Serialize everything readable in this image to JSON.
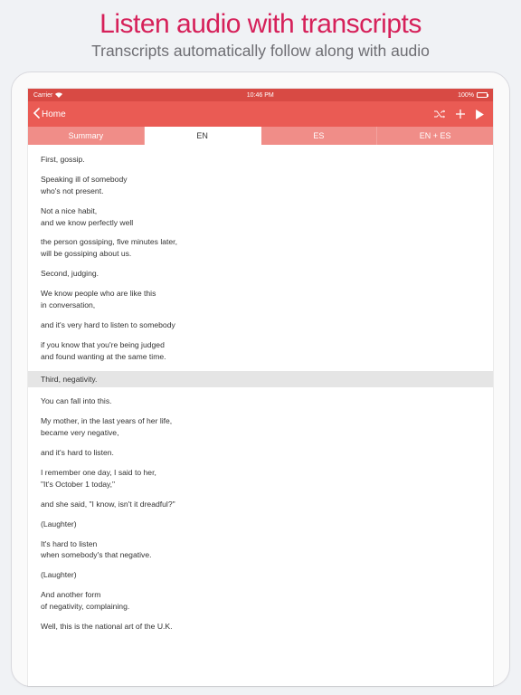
{
  "promo": {
    "title": "Listen audio with transcripts",
    "subtitle": "Transcripts automatically follow along with audio"
  },
  "statusbar": {
    "carrier": "Carrier",
    "time": "10:46 PM",
    "battery": "100%"
  },
  "nav": {
    "back": "Home"
  },
  "tabs": {
    "summary": "Summary",
    "en": "EN",
    "es": "ES",
    "en_es": "EN + ES"
  },
  "transcript": [
    {
      "type": "para",
      "lines": [
        "First, gossip."
      ]
    },
    {
      "type": "para",
      "lines": [
        "Speaking ill of somebody",
        "who's not present."
      ]
    },
    {
      "type": "para",
      "lines": [
        "Not a nice habit,",
        "and we know perfectly well"
      ]
    },
    {
      "type": "para",
      "lines": [
        "the person gossiping, five minutes later,",
        "will be gossiping about us."
      ]
    },
    {
      "type": "para",
      "lines": [
        "Second, judging."
      ]
    },
    {
      "type": "para",
      "lines": [
        "We know people who are like this",
        "in conversation,"
      ]
    },
    {
      "type": "para",
      "lines": [
        "and it's very hard to listen to somebody"
      ]
    },
    {
      "type": "para",
      "lines": [
        "if you know that you're being judged",
        "and found wanting at the same time."
      ]
    },
    {
      "type": "highlight",
      "lines": [
        "Third, negativity."
      ]
    },
    {
      "type": "para",
      "lines": [
        "You can fall into this."
      ]
    },
    {
      "type": "para",
      "lines": [
        "My mother, in the last years of her life,",
        "became very negative,"
      ]
    },
    {
      "type": "para",
      "lines": [
        "and it's hard to listen."
      ]
    },
    {
      "type": "para",
      "lines": [
        "I remember one day, I said to her,",
        "\"It's October 1 today,\""
      ]
    },
    {
      "type": "para",
      "lines": [
        "and she said, \"I know, isn't it dreadful?\""
      ]
    },
    {
      "type": "para",
      "lines": [
        "(Laughter)"
      ]
    },
    {
      "type": "para",
      "lines": [
        "It's hard to listen",
        "when somebody's that negative."
      ]
    },
    {
      "type": "para",
      "lines": [
        "(Laughter)"
      ]
    },
    {
      "type": "para",
      "lines": [
        "And another form",
        "of negativity, complaining."
      ]
    },
    {
      "type": "para",
      "lines": [
        "Well, this is the national art of the U.K."
      ]
    }
  ]
}
